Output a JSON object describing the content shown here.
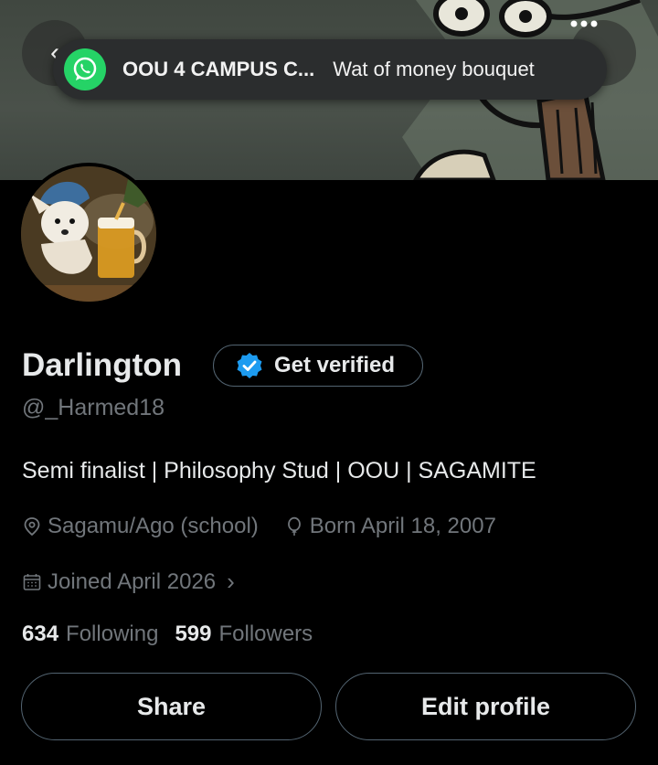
{
  "notification": {
    "app_icon": "whatsapp-icon",
    "title": "OOU 4 CAMPUS C...",
    "message": "Wat of money bouquet"
  },
  "header": {
    "back_icon": "back-arrow-icon",
    "back_glyph": "‹",
    "more_icon": "more-icon"
  },
  "profile": {
    "name": "Darlington",
    "verify_label": "Get verified",
    "handle": "@_Harmed18",
    "bio": "Semi finalist | Philosophy Stud | OOU | SAGAMITE",
    "location": "Sagamu/Ago (school)",
    "birthday": "Born April 18, 2007",
    "joined": "Joined April 2026",
    "joined_chevron": "›",
    "following_count": "634",
    "following_label": "Following",
    "followers_count": "599",
    "followers_label": "Followers"
  },
  "actions": {
    "share_label": "Share",
    "edit_label": "Edit profile"
  },
  "colors": {
    "background": "#000000",
    "text_primary": "#e7e9ea",
    "text_secondary": "#71767b",
    "border": "#536471",
    "verified_blue": "#1d9bf0",
    "whatsapp_green": "#25d366"
  }
}
